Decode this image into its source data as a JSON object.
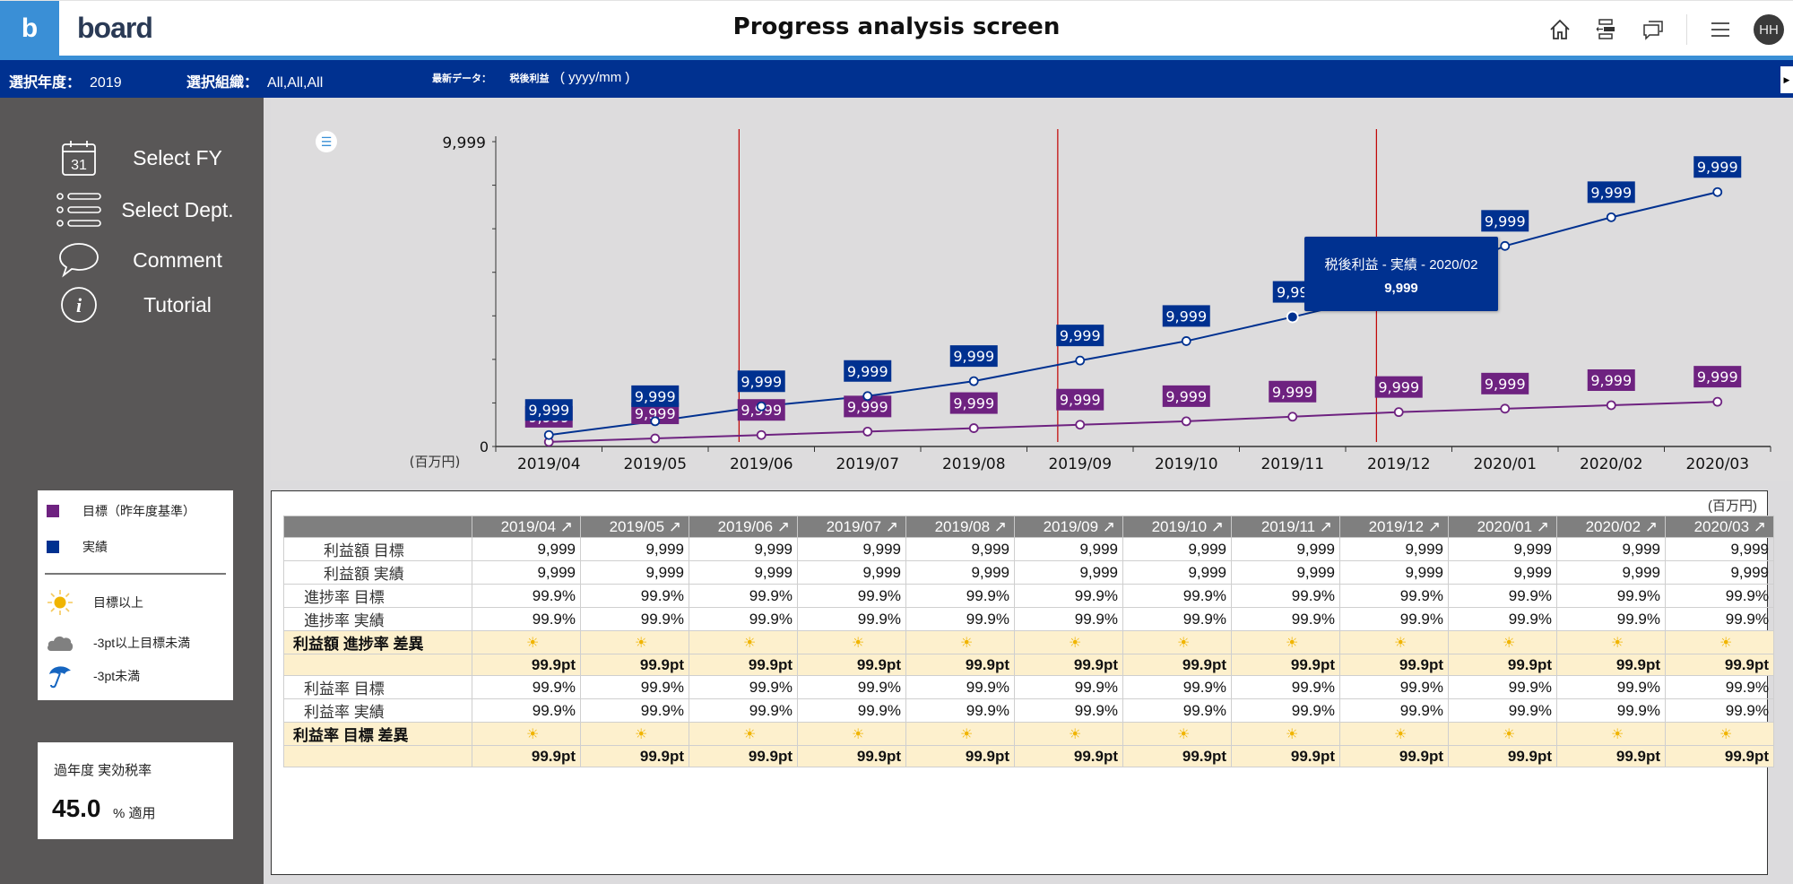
{
  "header": {
    "logo_mark": "b",
    "logo_word": "board",
    "title": "Progress analysis screen",
    "icons": [
      "home-icon",
      "navigation-panel-icon",
      "comments-icon",
      "menu-icon"
    ],
    "avatar_initials": "HH"
  },
  "filters": {
    "year_label": "選択年度：",
    "year_value": "2019",
    "org_label": "選択組織：",
    "org_value": "All,All,All",
    "latest_label": "最新データ：",
    "latest_measure": "税後利益",
    "latest_value": "( yyyy/mm )"
  },
  "sidebar": {
    "items": [
      {
        "label": "Select FY",
        "icon": "calendar-icon",
        "icon_text": "31"
      },
      {
        "label": "Select Dept.",
        "icon": "list-icon"
      },
      {
        "label": "Comment",
        "icon": "speech-bubble-icon"
      },
      {
        "label": "Tutorial",
        "icon": "info-icon",
        "icon_text": "i"
      }
    ],
    "legend": {
      "series": [
        {
          "label": "目標（昨年度基準）",
          "color": "#6e2280"
        },
        {
          "label": "実績",
          "color": "#003190"
        }
      ],
      "status": [
        {
          "label": "目標以上",
          "icon": "sun-icon"
        },
        {
          "label": "-3pt以上目標未満",
          "icon": "cloud-icon"
        },
        {
          "label": "-3pt未満",
          "icon": "umbrella-icon"
        }
      ]
    },
    "tax": {
      "label": "過年度 実効税率",
      "value": "45.0",
      "unit": "% 適用"
    }
  },
  "chart_data": {
    "type": "line",
    "title": "",
    "xlabel": "",
    "ylabel": "(百万円)",
    "ylim": [
      0,
      9999
    ],
    "y_ticks": [
      "0",
      "9,999"
    ],
    "grid": false,
    "categories": [
      "2019/04",
      "2019/05",
      "2019/06",
      "2019/07",
      "2019/08",
      "2019/09",
      "2019/10",
      "2019/11",
      "2019/12",
      "2020/01",
      "2020/02",
      "2020/03"
    ],
    "series": [
      {
        "name": "実績",
        "color": "#003190",
        "values": [
          376,
          827,
          1316,
          1654,
          2143,
          2819,
          3458,
          4248,
          5075,
          6578,
          7518,
          8345
        ],
        "labels": [
          "9,999",
          "9,999",
          "9,999",
          "9,999",
          "9,999",
          "9,999",
          "9,999",
          "9,99",
          "9,999",
          "9,999",
          "9,999",
          "9,999"
        ]
      },
      {
        "name": "目標（昨年度基準）",
        "color": "#6e2280",
        "values": [
          150,
          263,
          376,
          489,
          601,
          714,
          827,
          977,
          1128,
          1240,
          1353,
          1466
        ],
        "labels": [
          "9,999",
          "9,999",
          "9,999",
          "9,999",
          "9,999",
          "9,999",
          "9,999",
          "9,999",
          "9,999",
          "9,999",
          "9,999",
          "9,999"
        ]
      }
    ],
    "reference_lines_after": [
      "2019/06",
      "2019/09",
      "2019/12"
    ],
    "reference_line_color": "#c00000",
    "highlighted_point": {
      "series": "実績",
      "category": "2019/11"
    },
    "tooltip": {
      "title": "税後利益 - 実績 - 2020/02",
      "value": "9,999"
    },
    "legend": "none"
  },
  "table": {
    "unit": "(百万円)",
    "columns": [
      "2019/04 ↗",
      "2019/05 ↗",
      "2019/06 ↗",
      "2019/07 ↗",
      "2019/08 ↗",
      "2019/09 ↗",
      "2019/10 ↗",
      "2019/11 ↗",
      "2019/12 ↗",
      "2020/01 ↗",
      "2020/02 ↗",
      "2020/03 ↗"
    ],
    "rows": [
      {
        "label": "利益額 目標",
        "style": "indent",
        "cells": [
          "9,999",
          "9,999",
          "9,999",
          "9,999",
          "9,999",
          "9,999",
          "9,999",
          "9,999",
          "9,999",
          "9,999",
          "9,999",
          "9,999"
        ]
      },
      {
        "label": "利益額 実績",
        "style": "indent",
        "cells": [
          "9,999",
          "9,999",
          "9,999",
          "9,999",
          "9,999",
          "9,999",
          "9,999",
          "9,999",
          "9,999",
          "9,999",
          "9,999",
          "9,999"
        ]
      },
      {
        "label": "進捗率 目標",
        "style": "indent2",
        "cells": [
          "99.9%",
          "99.9%",
          "99.9%",
          "99.9%",
          "99.9%",
          "99.9%",
          "99.9%",
          "99.9%",
          "99.9%",
          "99.9%",
          "99.9%",
          "99.9%"
        ]
      },
      {
        "label": "進捗率 実績",
        "style": "indent2",
        "cells": [
          "99.9%",
          "99.9%",
          "99.9%",
          "99.9%",
          "99.9%",
          "99.9%",
          "99.9%",
          "99.9%",
          "99.9%",
          "99.9%",
          "99.9%",
          "99.9%"
        ]
      },
      {
        "label": "利益額 進捗率 差異",
        "style": "status",
        "cells": [
          "sun",
          "sun",
          "sun",
          "sun",
          "sun",
          "sun",
          "sun",
          "sun",
          "sun",
          "sun",
          "sun",
          "sun"
        ]
      },
      {
        "label": "",
        "style": "pt",
        "cells": [
          "99.9pt",
          "99.9pt",
          "99.9pt",
          "99.9pt",
          "99.9pt",
          "99.9pt",
          "99.9pt",
          "99.9pt",
          "99.9pt",
          "99.9pt",
          "99.9pt",
          "99.9pt"
        ]
      },
      {
        "label": "利益率 目標",
        "style": "indent2",
        "cells": [
          "99.9%",
          "99.9%",
          "99.9%",
          "99.9%",
          "99.9%",
          "99.9%",
          "99.9%",
          "99.9%",
          "99.9%",
          "99.9%",
          "99.9%",
          "99.9%"
        ]
      },
      {
        "label": "利益率 実績",
        "style": "indent2",
        "cells": [
          "99.9%",
          "99.9%",
          "99.9%",
          "99.9%",
          "99.9%",
          "99.9%",
          "99.9%",
          "99.9%",
          "99.9%",
          "99.9%",
          "99.9%",
          "99.9%"
        ]
      },
      {
        "label": "利益率 目標 差異",
        "style": "status",
        "cells": [
          "sun",
          "sun",
          "sun",
          "sun",
          "sun",
          "sun",
          "sun",
          "sun",
          "sun",
          "sun",
          "sun",
          "sun"
        ]
      },
      {
        "label": "",
        "style": "pt",
        "cells": [
          "99.9pt",
          "99.9pt",
          "99.9pt",
          "99.9pt",
          "99.9pt",
          "99.9pt",
          "99.9pt",
          "99.9pt",
          "99.9pt",
          "99.9pt",
          "99.9pt",
          "99.9pt"
        ]
      }
    ],
    "status_glyph": "☀"
  }
}
